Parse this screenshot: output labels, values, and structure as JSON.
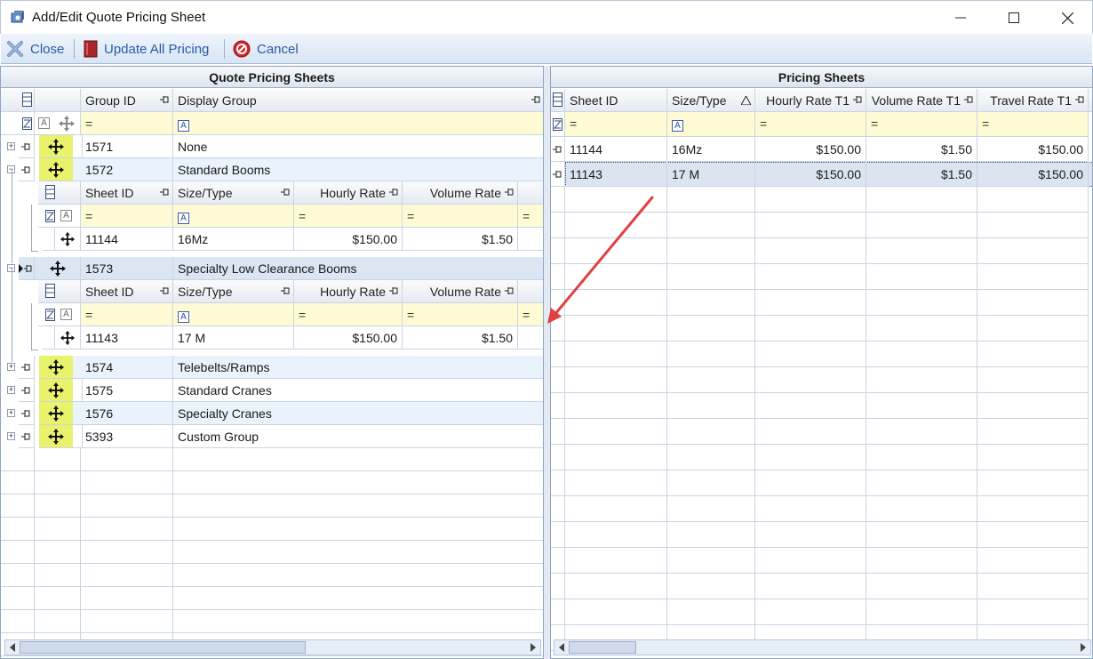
{
  "window": {
    "title": "Add/Edit Quote Pricing Sheet"
  },
  "toolbar": {
    "close_label": "Close",
    "update_label": "Update All Pricing",
    "cancel_label": "Cancel"
  },
  "left": {
    "title": "Quote Pricing Sheets",
    "headers": {
      "group_id": "Group ID",
      "display_group": "Display Group"
    },
    "groups": [
      {
        "id": "1571",
        "name": "None"
      },
      {
        "id": "1572",
        "name": "Standard Booms"
      },
      {
        "id": "1573",
        "name": "Specialty Low Clearance Booms"
      },
      {
        "id": "1574",
        "name": "Telebelts/Ramps"
      },
      {
        "id": "1575",
        "name": "Standard Cranes"
      },
      {
        "id": "1576",
        "name": "Specialty Cranes"
      },
      {
        "id": "5393",
        "name": "Custom Group"
      }
    ],
    "child_headers": {
      "sheet_id": "Sheet ID",
      "size_type": "Size/Type",
      "hourly": "Hourly Rate",
      "volume": "Volume Rate"
    },
    "child_1572": {
      "sheet_id": "11144",
      "size_type": "16Mz",
      "hourly": "$150.00",
      "volume": "$1.50"
    },
    "child_1573": {
      "sheet_id": "11143",
      "size_type": "17 M",
      "hourly": "$150.00",
      "volume": "$1.50"
    },
    "filter_eq": "="
  },
  "right": {
    "title": "Pricing Sheets",
    "headers": {
      "sheet_id": "Sheet ID",
      "size_type": "Size/Type",
      "hourly": "Hourly Rate T1",
      "volume": "Volume Rate T1",
      "travel": "Travel Rate T1"
    },
    "rows": [
      {
        "sheet_id": "11144",
        "size_type": "16Mz",
        "hourly": "$150.00",
        "volume": "$1.50",
        "travel": "$150.00"
      },
      {
        "sheet_id": "11143",
        "size_type": "17 M",
        "hourly": "$150.00",
        "volume": "$1.50",
        "travel": "$150.00"
      }
    ]
  },
  "colors": {
    "filter_bg": "#fefbd4",
    "move_highlight": "#e8f26b",
    "arrow": "#e0403f"
  }
}
